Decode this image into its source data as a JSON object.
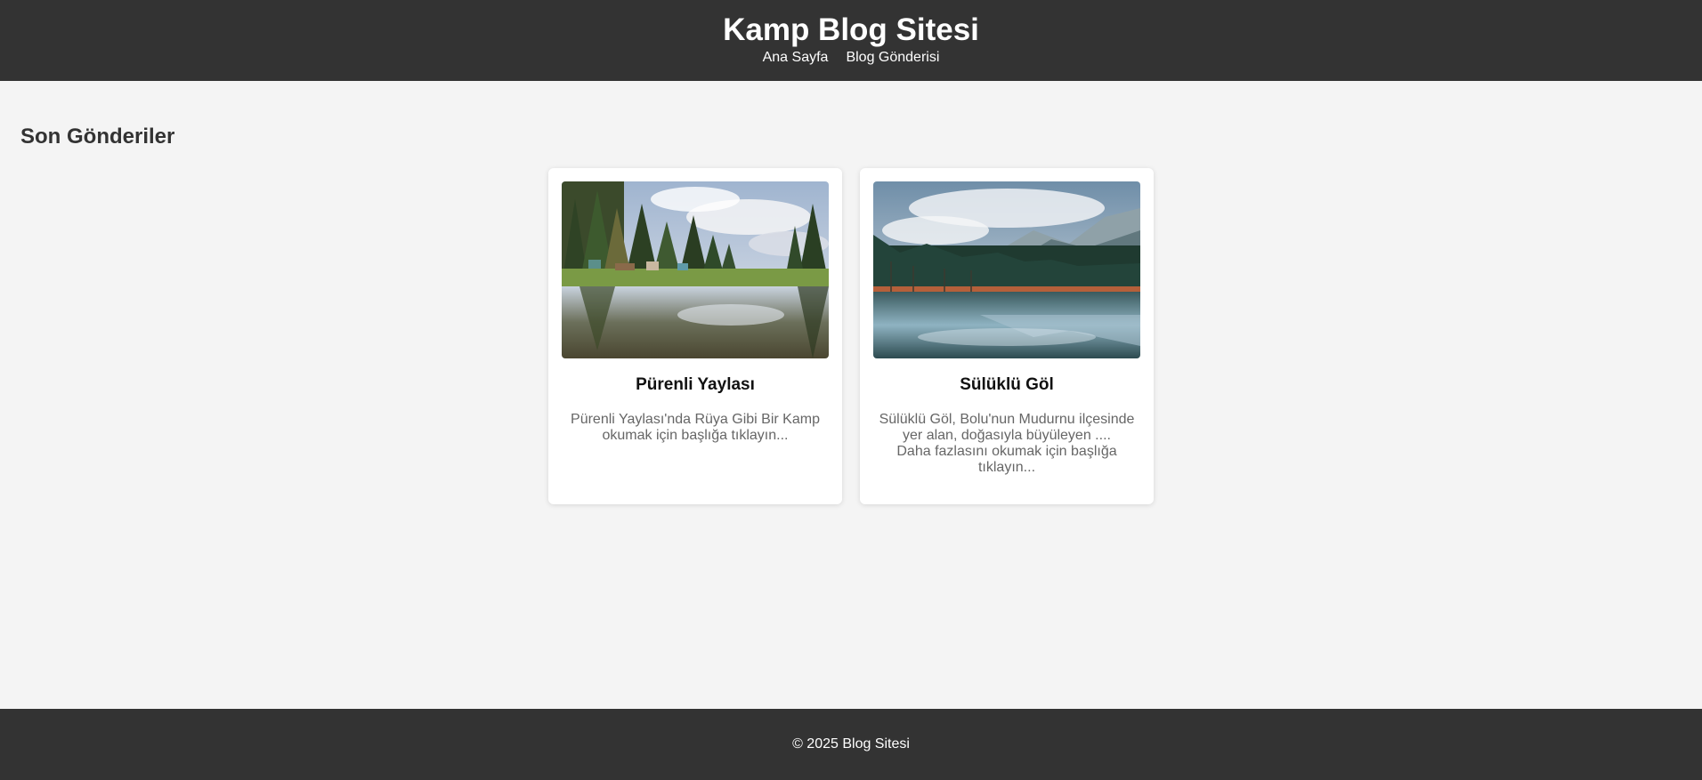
{
  "header": {
    "title": "Kamp Blog Sitesi",
    "nav": [
      {
        "label": "Ana Sayfa"
      },
      {
        "label": "Blog Gönderisi"
      }
    ]
  },
  "main": {
    "section_title": "Son Gönderiler",
    "posts": [
      {
        "title": "Pürenli Yaylası",
        "excerpt_lines": [
          "Pürenli Yaylası'nda Rüya Gibi Bir Kamp",
          "okumak için başlığa tıklayın..."
        ],
        "image_alt": "Forest lake with camp huts and reflections"
      },
      {
        "title": "Sülüklü Göl",
        "excerpt_lines": [
          "Sülüklü Göl, Bolu'nun Mudurnu ilçesinde",
          "yer alan, doğasıyla büyüleyen ....",
          "Daha fazlasını okumak için başlığa",
          "tıklayın..."
        ],
        "image_alt": "Mountain lake with misty peaks and reflections"
      }
    ]
  },
  "footer": {
    "text": "© 2025 Blog Sitesi"
  },
  "colors": {
    "header_bg": "#333333",
    "page_bg": "#f4f4f4",
    "card_bg": "#ffffff",
    "excerpt_text": "#666666"
  }
}
